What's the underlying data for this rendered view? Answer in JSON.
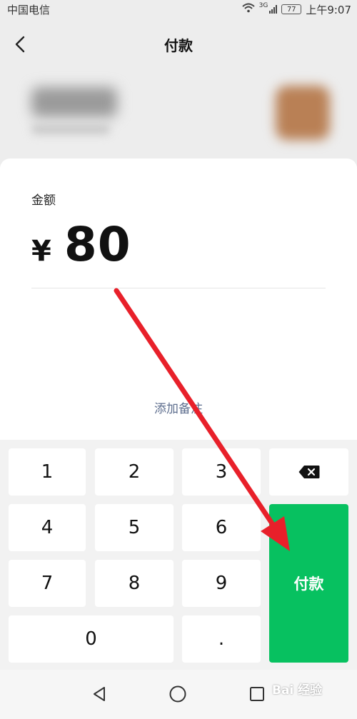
{
  "status_bar": {
    "carrier": "中国电信",
    "network": "3G",
    "battery": "77",
    "time": "上午9:07"
  },
  "header": {
    "title": "付款",
    "back_icon": "chevron-left-icon"
  },
  "payment": {
    "amount_label": "金额",
    "currency_symbol": "¥",
    "amount": "80",
    "remark_link": "添加备注"
  },
  "keypad": {
    "keys": [
      "1",
      "2",
      "3",
      "4",
      "5",
      "6",
      "7",
      "8",
      "9",
      "0",
      "."
    ],
    "backspace_icon": "backspace-icon",
    "pay_button": "付款"
  },
  "nav_bar": {
    "icons": [
      "back-triangle-icon",
      "home-circle-icon",
      "recents-square-icon"
    ]
  },
  "watermark": "Bai 经验",
  "colors": {
    "accent_green": "#07c160",
    "annotation_red": "#e8202a",
    "remark_link": "#5f6f8f"
  }
}
